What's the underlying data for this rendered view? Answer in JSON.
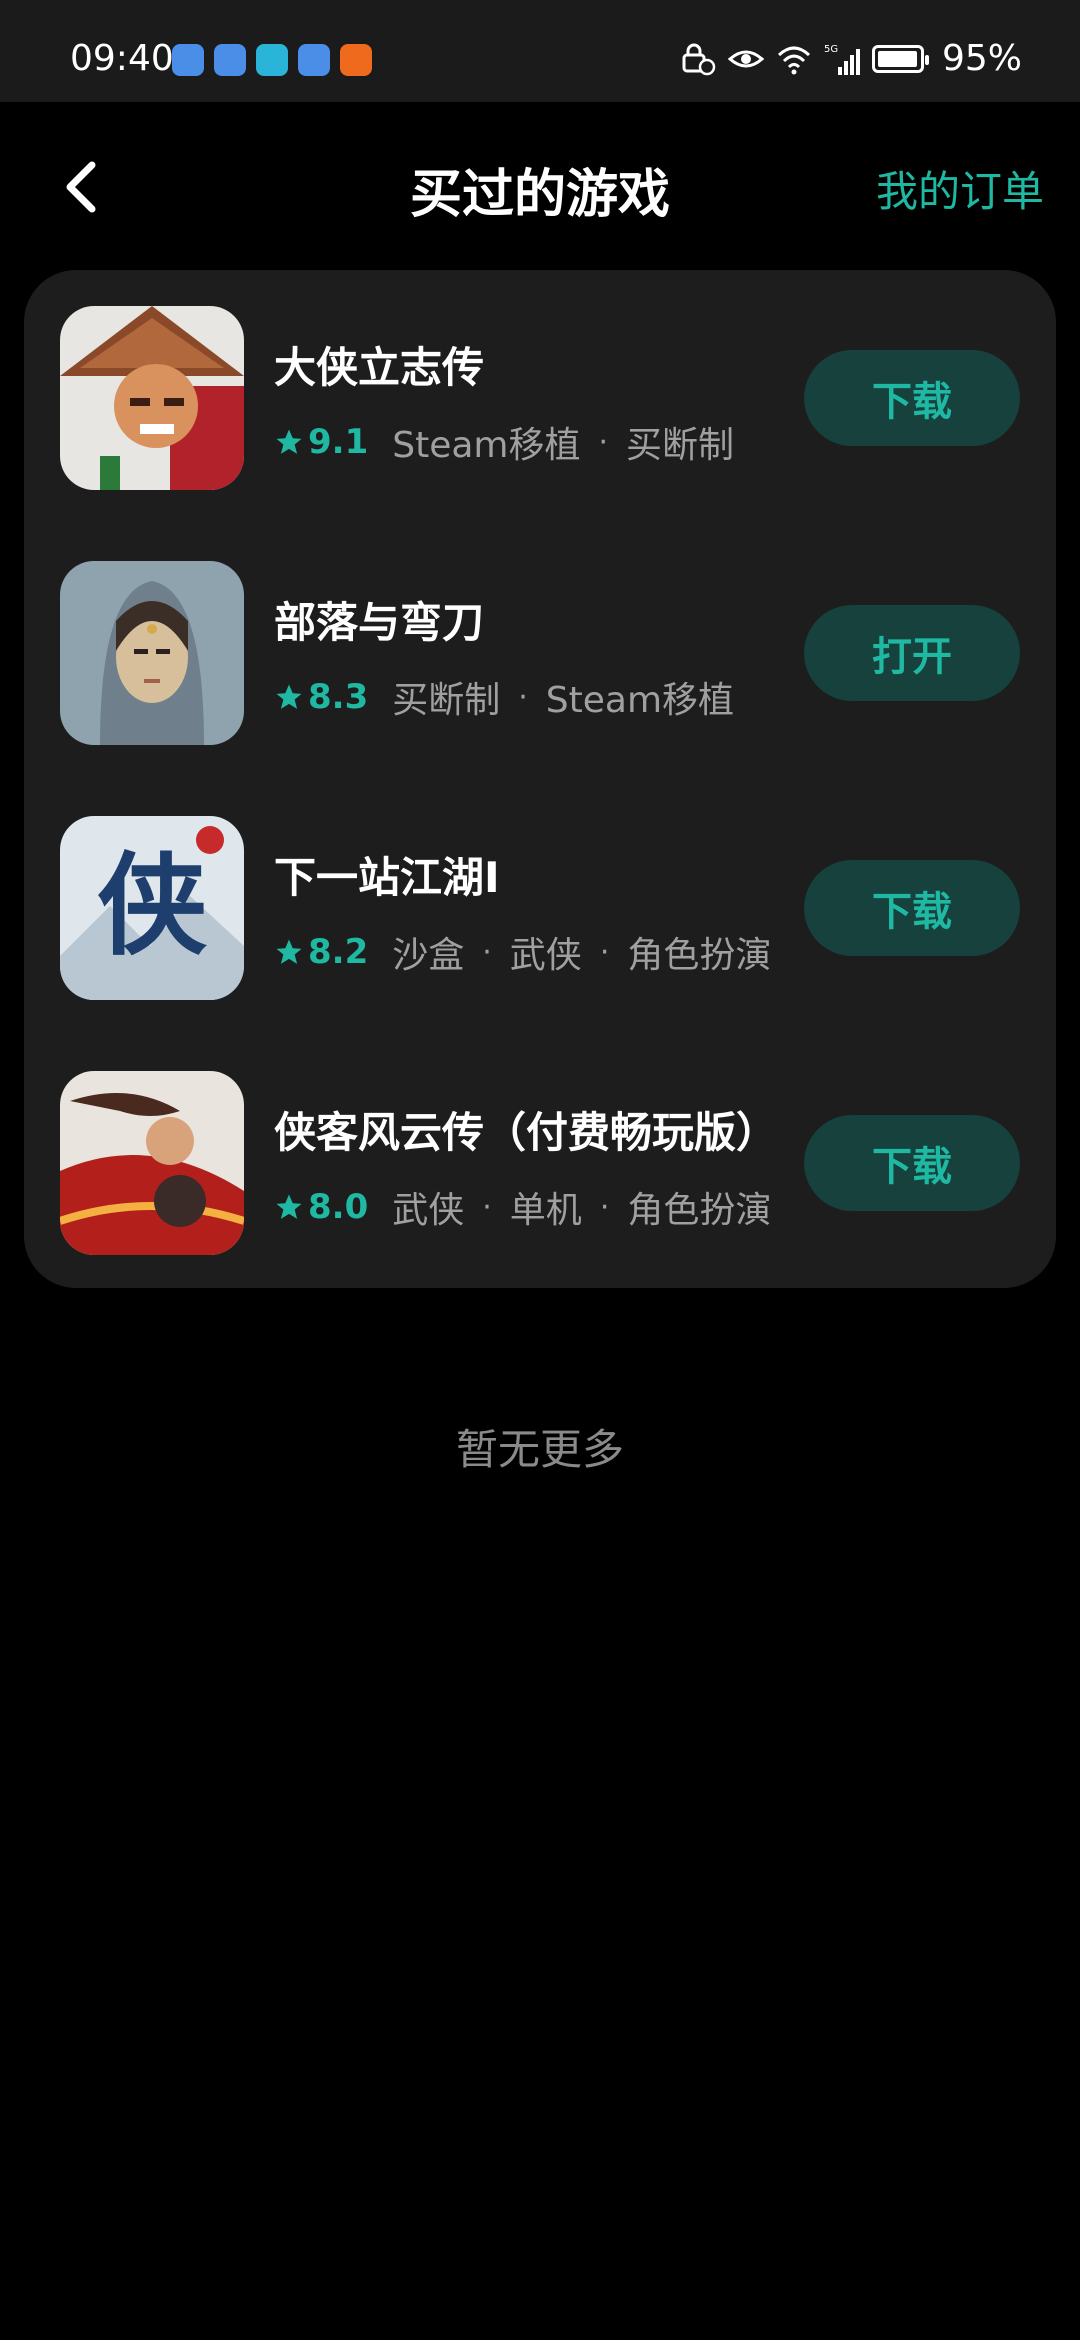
{
  "status_bar": {
    "time": "09:40",
    "battery_pct": "95%",
    "battery_level": 0.95,
    "network": "5G"
  },
  "header": {
    "title": "买过的游戏",
    "orders_label": "我的订单"
  },
  "games": [
    {
      "name": "大侠立志传",
      "rating": "9.1",
      "tags": [
        "Steam移植",
        "买断制"
      ],
      "action": "下载",
      "icon": "game-icon-daxia"
    },
    {
      "name": "部落与弯刀",
      "rating": "8.3",
      "tags": [
        "买断制",
        "Steam移植"
      ],
      "action": "打开",
      "icon": "game-icon-buluo"
    },
    {
      "name": "下一站江湖Ⅰ",
      "rating": "8.2",
      "tags": [
        "沙盒",
        "武侠",
        "角色扮演"
      ],
      "action": "下载",
      "icon": "game-icon-jianghu"
    },
    {
      "name": "侠客风云传（付费畅玩版）",
      "rating": "8.0",
      "tags": [
        "武侠",
        "单机",
        "角色扮演"
      ],
      "action": "下载",
      "icon": "game-icon-xiake"
    }
  ],
  "footer": {
    "no_more": "暂无更多"
  },
  "colors": {
    "accent": "#1fb8a3",
    "button_bg": "#16413c",
    "card_bg": "#1d1d1d",
    "background": "#000000"
  }
}
